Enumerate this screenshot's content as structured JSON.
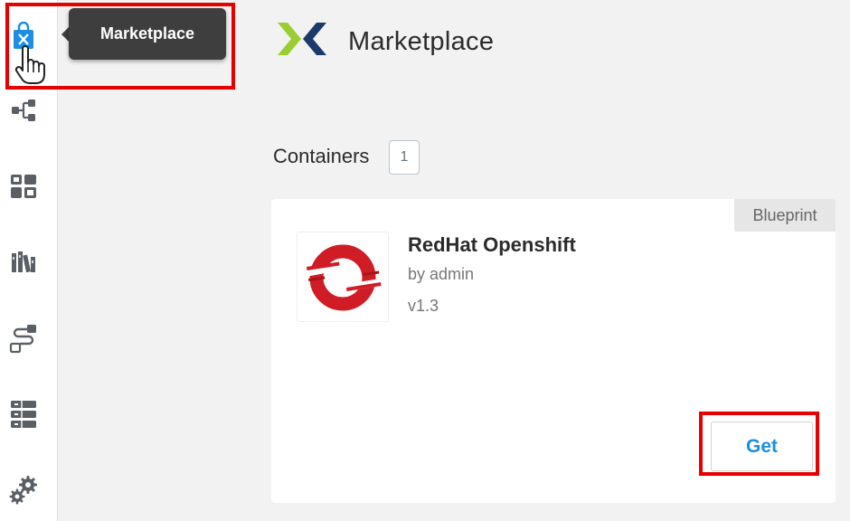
{
  "tooltip": {
    "text": "Marketplace"
  },
  "header": {
    "title": "Marketplace",
    "logo_icon": "nutanix-x-logo"
  },
  "sidebar": {
    "items": [
      {
        "icon": "marketplace-bag-icon",
        "active": true
      },
      {
        "icon": "hierarchy-icon"
      },
      {
        "icon": "grid-icon"
      },
      {
        "icon": "library-books-icon"
      },
      {
        "icon": "runbook-flow-icon"
      },
      {
        "icon": "server-list-icon"
      },
      {
        "icon": "settings-gears-icon"
      }
    ]
  },
  "section": {
    "title": "Containers",
    "count": "1"
  },
  "cards": [
    {
      "type_tag": "Blueprint",
      "name": "RedHat Openshift",
      "author": "by admin",
      "version": "v1.3",
      "action_label": "Get",
      "logo_icon": "openshift-logo"
    }
  ],
  "colors": {
    "accent": "#1b8fe3",
    "highlight": "#e60000",
    "openshift_red": "#d01c24",
    "logo_green": "#9acd32",
    "logo_navy": "#1b3a6b",
    "sidebar_icon": "#5a5f66"
  }
}
